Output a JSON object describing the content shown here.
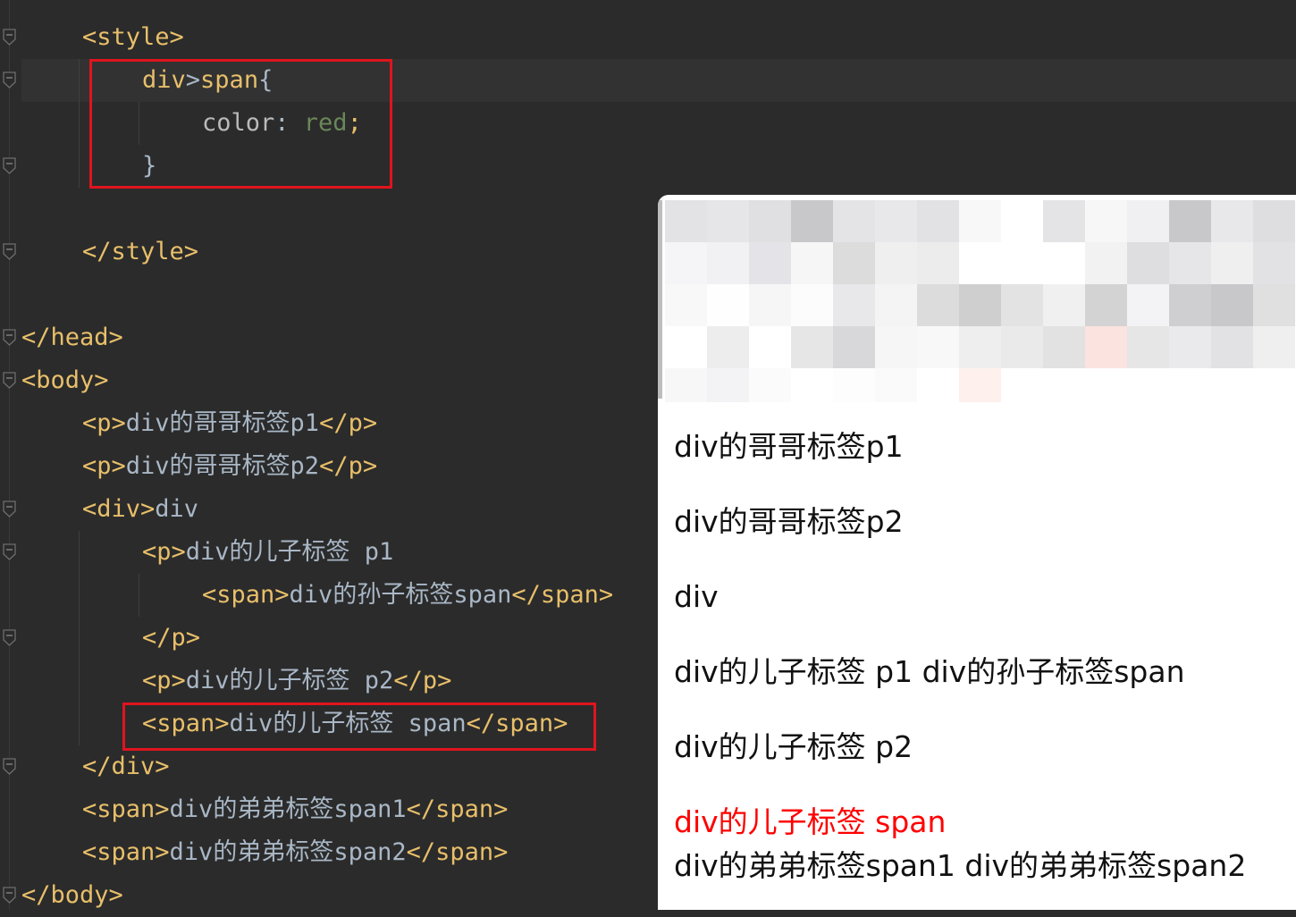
{
  "code_lines": [
    {
      "id": "l1",
      "parts": [
        {
          "c": "tag",
          "t": "<style>"
        }
      ]
    },
    {
      "id": "l2",
      "parts": [
        {
          "c": "sel",
          "t": "div"
        },
        {
          "c": "txt",
          "t": ">"
        },
        {
          "c": "sel",
          "t": "span"
        },
        {
          "c": "txt",
          "t": "{"
        }
      ]
    },
    {
      "id": "l3",
      "parts": [
        {
          "c": "prop",
          "t": "color"
        },
        {
          "c": "txt",
          "t": ": "
        },
        {
          "c": "val",
          "t": "red"
        },
        {
          "c": "tag",
          "t": ";"
        }
      ]
    },
    {
      "id": "l4",
      "parts": [
        {
          "c": "txt",
          "t": "}"
        }
      ]
    },
    {
      "id": "l5",
      "parts": []
    },
    {
      "id": "l6",
      "parts": [
        {
          "c": "tag",
          "t": "</style>"
        }
      ]
    },
    {
      "id": "l7",
      "parts": []
    },
    {
      "id": "l8",
      "parts": [
        {
          "c": "tag",
          "t": "</head>"
        }
      ]
    },
    {
      "id": "l9",
      "parts": [
        {
          "c": "tag",
          "t": "<body>"
        }
      ]
    },
    {
      "id": "l10",
      "parts": [
        {
          "c": "tag",
          "t": "<p>"
        },
        {
          "c": "txt",
          "t": "div的哥哥标签p1"
        },
        {
          "c": "tag",
          "t": "</p>"
        }
      ]
    },
    {
      "id": "l11",
      "parts": [
        {
          "c": "tag",
          "t": "<p>"
        },
        {
          "c": "txt",
          "t": "div的哥哥标签p2"
        },
        {
          "c": "tag",
          "t": "</p>"
        }
      ]
    },
    {
      "id": "l12",
      "parts": [
        {
          "c": "tag",
          "t": "<div>"
        },
        {
          "c": "txt",
          "t": "div"
        }
      ]
    },
    {
      "id": "l13",
      "parts": [
        {
          "c": "tag",
          "t": "<p>"
        },
        {
          "c": "txt",
          "t": "div的儿子标签 p1"
        }
      ]
    },
    {
      "id": "l14",
      "parts": [
        {
          "c": "tag",
          "t": "<span>"
        },
        {
          "c": "txt",
          "t": "div的孙子标签span"
        },
        {
          "c": "tag",
          "t": "</span>"
        }
      ]
    },
    {
      "id": "l15",
      "parts": [
        {
          "c": "tag",
          "t": "</p>"
        }
      ]
    },
    {
      "id": "l16",
      "parts": [
        {
          "c": "tag",
          "t": "<p>"
        },
        {
          "c": "txt",
          "t": "div的儿子标签 p2"
        },
        {
          "c": "tag",
          "t": "</p>"
        }
      ]
    },
    {
      "id": "l17",
      "parts": [
        {
          "c": "tag",
          "t": "<span>"
        },
        {
          "c": "txt",
          "t": "div的儿子标签 span"
        },
        {
          "c": "tag",
          "t": "</span>"
        }
      ]
    },
    {
      "id": "l18",
      "parts": [
        {
          "c": "tag",
          "t": "</div>"
        }
      ]
    },
    {
      "id": "l19",
      "parts": [
        {
          "c": "tag",
          "t": "<span>"
        },
        {
          "c": "txt",
          "t": "div的弟弟标签span1"
        },
        {
          "c": "tag",
          "t": "</span>"
        }
      ]
    },
    {
      "id": "l20",
      "parts": [
        {
          "c": "tag",
          "t": "<span>"
        },
        {
          "c": "txt",
          "t": "div的弟弟标签span2"
        },
        {
          "c": "tag",
          "t": "</span>"
        }
      ]
    },
    {
      "id": "l21",
      "parts": [
        {
          "c": "tag",
          "t": "</body>"
        }
      ]
    }
  ],
  "preview": {
    "p1": "div的哥哥标签p1",
    "p2": "div的哥哥标签p2",
    "div_text": "div",
    "child_p1": "div的儿子标签 p1 div的孙子标签span",
    "child_p2": "div的儿子标签 p2",
    "child_span": "div的儿子标签 span",
    "siblings": "div的弟弟标签span1 div的弟弟标签span2",
    "highlight_color": "#ff0000"
  },
  "colors": {
    "editor_bg": "#2b2b2b",
    "tag": "#e8bf6a",
    "text": "#a9b7c6",
    "value": "#6a8759",
    "highlight_box": "#e0141e"
  }
}
